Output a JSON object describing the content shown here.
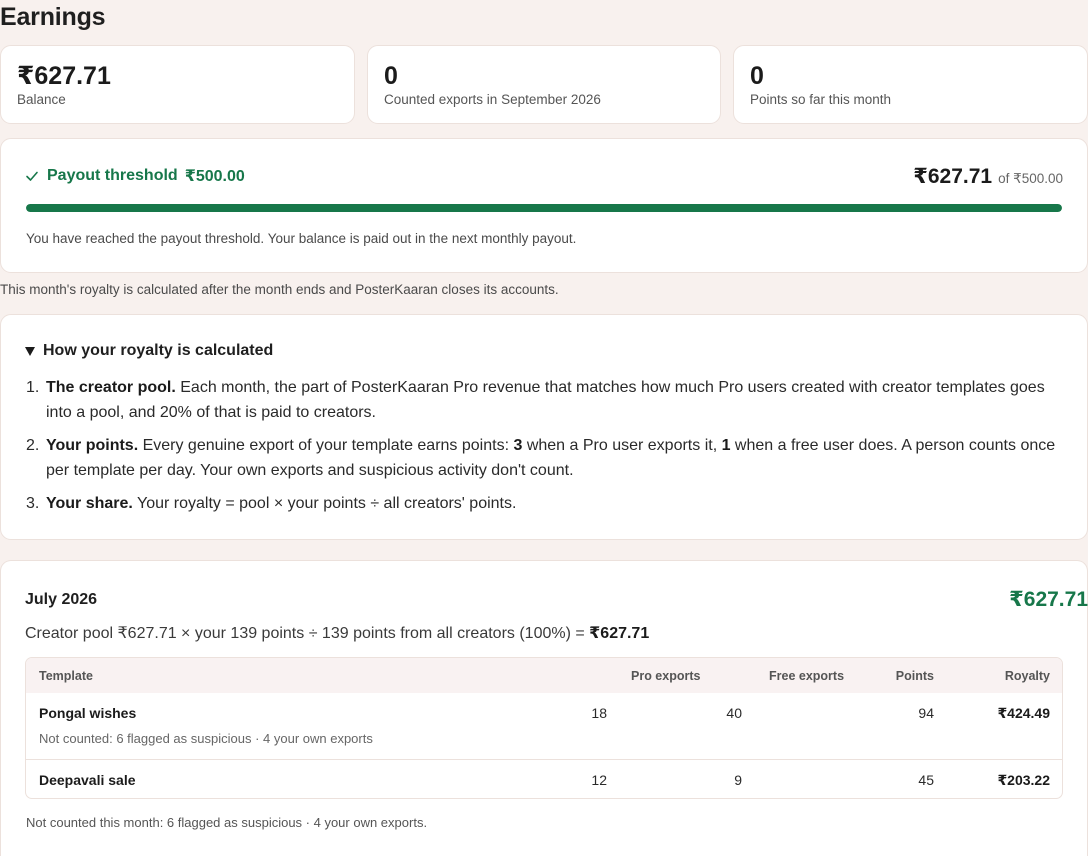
{
  "page": {
    "title": "Earnings"
  },
  "stats": [
    {
      "value": "₹627.71",
      "label": "Balance"
    },
    {
      "value": "0",
      "label": "Counted exports in September 2026"
    },
    {
      "value": "0",
      "label": "Points so far this month"
    }
  ],
  "payout": {
    "label": "Payout threshold",
    "threshold": "₹500.00",
    "balance": "₹627.71",
    "of_text": "of ₹500.00",
    "progress_fraction": 1.0,
    "note": "You have reached the payout threshold. Your balance is paid out in the next monthly payout."
  },
  "month_note": "This month's royalty is calculated after the month ends and PosterKaaran closes its accounts.",
  "explainer": {
    "summary": "How your royalty is calculated",
    "items": [
      {
        "num": "1.",
        "title": "The creator pool.",
        "text": " Each month, the part of PosterKaaran Pro revenue that matches how much Pro users created with creator templates goes into a pool, and 20% of that is paid to creators."
      },
      {
        "num": "2.",
        "title": "Your points.",
        "text_a": " Every genuine export of your template earns points: ",
        "pro_pts": "3",
        "text_b": " when a Pro user exports it, ",
        "free_pts": "1",
        "text_c": " when a free user does. A person counts once per template per day. Your own exports and suspicious activity don't count."
      },
      {
        "num": "3.",
        "title": "Your share.",
        "text": " Your royalty = pool × your points ÷ all creators' points."
      }
    ]
  },
  "month": {
    "title": "July 2026",
    "total": "₹627.71",
    "formula": "Creator pool ₹627.71 × your 139 points ÷ 139 points from all creators (100%) = ",
    "formula_result": "₹627.71",
    "columns": [
      "Template",
      "Pro exports",
      "Free exports",
      "Points",
      "Royalty"
    ],
    "rows": [
      {
        "template": "Pongal wishes",
        "pro": "18",
        "free": "40",
        "points": "94",
        "royalty": "₹424.49",
        "note": "Not counted: 6 flagged as suspicious · 4 your own exports"
      },
      {
        "template": "Deepavali sale",
        "pro": "12",
        "free": "9",
        "points": "45",
        "royalty": "₹203.22"
      }
    ],
    "footnote": "Not counted this month: 6 flagged as suspicious · 4 your own exports."
  },
  "colors": {
    "accent_green": "#17774a",
    "page_bg": "#f8f1ee",
    "card_border": "#ece1dc"
  }
}
